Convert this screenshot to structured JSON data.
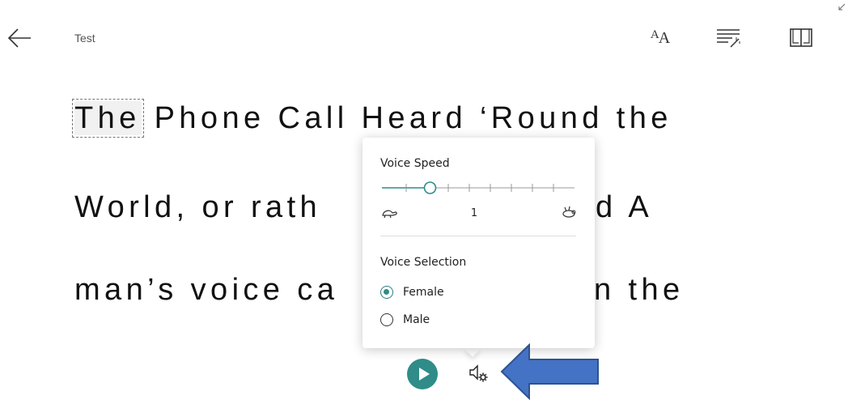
{
  "header": {
    "title": "Test",
    "icons": [
      "back-arrow-icon",
      "text-size-icon",
      "grammar-options-icon",
      "reading-preferences-icon"
    ],
    "text_size_glyph": {
      "small": "A",
      "big": "A"
    }
  },
  "reading_text": {
    "highlighted_word": "The",
    "line1_rest": " Phone Call Heard ‘Round the",
    "line2": "World, or rath",
    "line2_tail": "d A",
    "line3": "man’s voice ca",
    "line3_tail": "n the"
  },
  "voice_popup": {
    "speed_label": "Voice Speed",
    "speed_value": "1",
    "speed_level_fraction": 0.25,
    "slider_ticks": 8,
    "voice_selection_label": "Voice Selection",
    "voices": [
      {
        "label": "Female",
        "selected": true
      },
      {
        "label": "Male",
        "selected": false
      }
    ]
  },
  "playback": {
    "play_icon": "play-icon",
    "settings_icon": "voice-settings-icon"
  },
  "colors": {
    "accent": "#2f8c88",
    "annotation_arrow": "#4472c4",
    "annotation_arrow_border": "#2f528f"
  }
}
